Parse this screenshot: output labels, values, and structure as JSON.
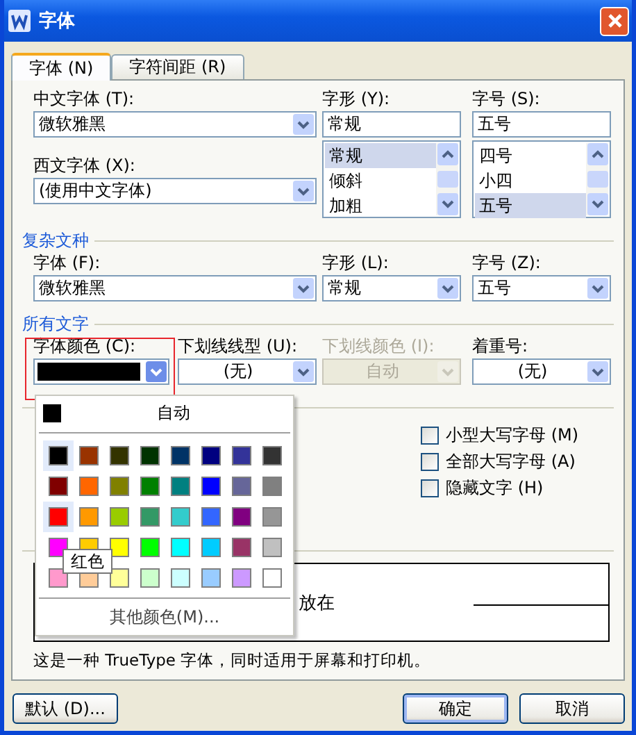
{
  "window": {
    "title": "字体"
  },
  "tabs": [
    {
      "label": "字体 (N)",
      "selected": true
    },
    {
      "label": "字符间距 (R)",
      "selected": false
    }
  ],
  "chinese_font": {
    "label": "中文字体 (T):",
    "value": "微软雅黑"
  },
  "style": {
    "label": "字形 (Y):",
    "value": "常规",
    "options": [
      {
        "label": "常规",
        "selected": true
      },
      {
        "label": "倾斜",
        "selected": false
      },
      {
        "label": "加粗",
        "selected": false
      }
    ]
  },
  "size": {
    "label": "字号 (S):",
    "value": "五号",
    "options": [
      {
        "label": "四号",
        "selected": false
      },
      {
        "label": "小四",
        "selected": false
      },
      {
        "label": "五号",
        "selected": true
      }
    ]
  },
  "western_font": {
    "label": "西文字体 (X):",
    "value": "(使用中文字体)"
  },
  "complex_section": {
    "title": "复杂文种",
    "fields": [
      {
        "label": "字体 (F):",
        "value": "微软雅黑"
      },
      {
        "label": "字形 (L):",
        "value": "常规"
      },
      {
        "label": "字号 (Z):",
        "value": "五号"
      }
    ]
  },
  "all_text_section": {
    "title": "所有文字",
    "fields": [
      {
        "kind": "color",
        "label": "字体颜色 (C):",
        "color": "#000000",
        "disabled": false
      },
      {
        "kind": "text",
        "label": "下划线线型 (U):",
        "value": "(无)",
        "disabled": false
      },
      {
        "kind": "text",
        "label": "下划线颜色 (I):",
        "value": "自动",
        "disabled": true
      },
      {
        "kind": "text",
        "label": "着重号:",
        "value": "(无)",
        "disabled": false
      }
    ]
  },
  "effects_section": {
    "checkboxes": [
      {
        "label": "小型大写字母 (M)",
        "checked": false
      },
      {
        "label": "全部大写字母 (A)",
        "checked": false
      },
      {
        "label": "隐藏文字 (H)",
        "checked": false
      }
    ]
  },
  "preview_section": {
    "sample": "放在"
  },
  "description": "这是一种 TrueType 字体，同时适用于屏幕和打印机。",
  "buttons": [
    {
      "label": "默认 (D)...",
      "default": false
    },
    {
      "label": "确定",
      "default": true
    },
    {
      "label": "取消",
      "default": false
    }
  ],
  "color_popup": {
    "automatic": "自动",
    "tooltip": "红色",
    "more": "其他颜色(M)...",
    "swatches": [
      {
        "color": "#000000",
        "selected": true
      },
      {
        "color": "#993300",
        "selected": false
      },
      {
        "color": "#333300",
        "selected": false
      },
      {
        "color": "#003300",
        "selected": false
      },
      {
        "color": "#003366",
        "selected": false
      },
      {
        "color": "#000080",
        "selected": false
      },
      {
        "color": "#333399",
        "selected": false
      },
      {
        "color": "#333333",
        "selected": false
      },
      {
        "color": "#800000",
        "selected": false
      },
      {
        "color": "#ff6600",
        "selected": false
      },
      {
        "color": "#808000",
        "selected": false
      },
      {
        "color": "#008000",
        "selected": false
      },
      {
        "color": "#008080",
        "selected": false
      },
      {
        "color": "#0000ff",
        "selected": false
      },
      {
        "color": "#666699",
        "selected": false
      },
      {
        "color": "#808080",
        "selected": false
      },
      {
        "color": "#ff0000",
        "selected": true
      },
      {
        "color": "#ff9900",
        "selected": false
      },
      {
        "color": "#99cc00",
        "selected": false
      },
      {
        "color": "#339966",
        "selected": false
      },
      {
        "color": "#33cccc",
        "selected": false
      },
      {
        "color": "#3366ff",
        "selected": false
      },
      {
        "color": "#800080",
        "selected": false
      },
      {
        "color": "#969696",
        "selected": false
      },
      {
        "color": "#ff00ff",
        "selected": false
      },
      {
        "color": "#ffcc00",
        "selected": false
      },
      {
        "color": "#ffff00",
        "selected": false
      },
      {
        "color": "#00ff00",
        "selected": false
      },
      {
        "color": "#00ffff",
        "selected": false
      },
      {
        "color": "#00ccff",
        "selected": false
      },
      {
        "color": "#993366",
        "selected": false
      },
      {
        "color": "#c0c0c0",
        "selected": false
      },
      {
        "color": "#ff99cc",
        "selected": false
      },
      {
        "color": "#ffcc99",
        "selected": false
      },
      {
        "color": "#ffff99",
        "selected": false
      },
      {
        "color": "#ccffcc",
        "selected": false
      },
      {
        "color": "#ccffff",
        "selected": false
      },
      {
        "color": "#99ccff",
        "selected": false
      },
      {
        "color": "#cc99ff",
        "selected": false
      },
      {
        "color": "#ffffff",
        "selected": false
      }
    ]
  }
}
